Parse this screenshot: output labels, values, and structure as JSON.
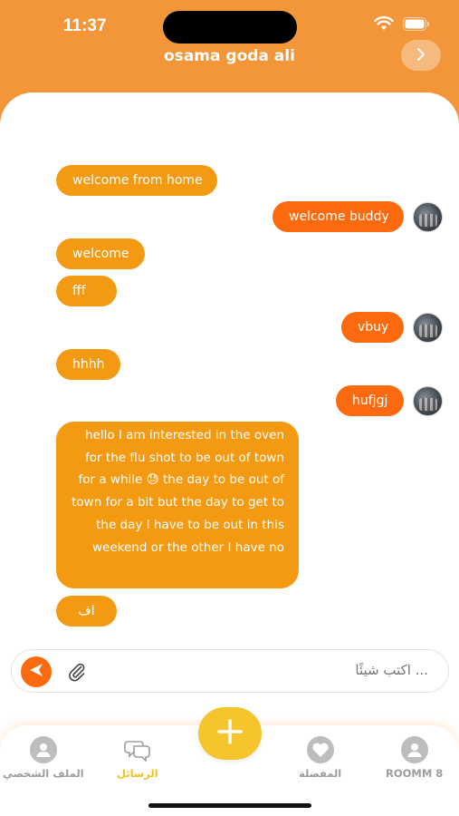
{
  "status": {
    "time": "11:37"
  },
  "header": {
    "title": "osama goda ali",
    "nav_icon": "chevron-right-icon"
  },
  "messages": [
    {
      "text": "welcome from home",
      "dir": "received"
    },
    {
      "text": "welcome buddy",
      "dir": "sent"
    },
    {
      "text": "welcome",
      "dir": "received"
    },
    {
      "text": "fff",
      "dir": "received"
    },
    {
      "text": "vbuy",
      "dir": "sent"
    },
    {
      "text": "hhhh",
      "dir": "received"
    },
    {
      "text": "hufjgj",
      "dir": "sent"
    },
    {
      "text": "hello I am interested in the oven for the flu shot to be out of town for a while 😓  the day to be out of town for a bit but the day to get to the day I have to be out in this weekend or the other I have no",
      "dir": "received"
    },
    {
      "text": "اف",
      "dir": "received"
    }
  ],
  "composer": {
    "placeholder": "اكتب شيئًا ..."
  },
  "tabs": [
    {
      "label": "الملف الشخصي",
      "icon": "profile-icon",
      "active": false
    },
    {
      "label": "الرسائل",
      "icon": "chat-icon",
      "active": true
    },
    {
      "label": "المفضلة",
      "icon": "heart-icon",
      "active": false
    },
    {
      "label": "ROOMM 8",
      "icon": "user-icon",
      "active": false
    }
  ],
  "colors": {
    "brand": "#f3963a",
    "sent": "#fb6a0e",
    "received": "#f39a12",
    "active_tab": "#f3c21a",
    "fab": "#f6c52e"
  }
}
